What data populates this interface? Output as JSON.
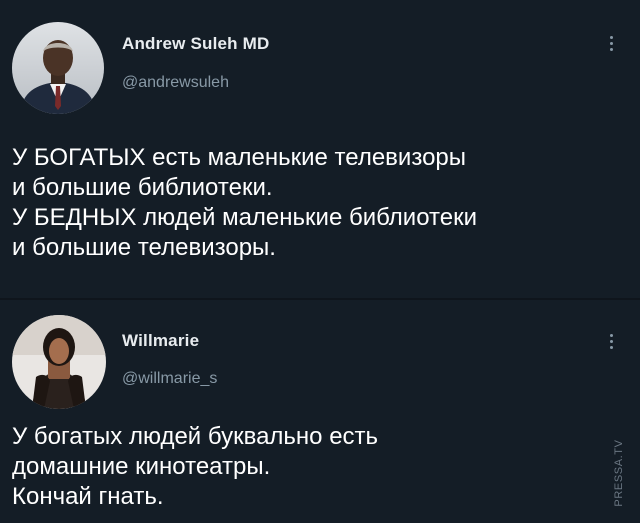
{
  "tweets": [
    {
      "display_name": "Andrew Suleh MD",
      "handle": "@andrewsuleh",
      "avatar_icon": "person-photo-icon",
      "more_icon": "vertical-ellipsis-icon",
      "text_lines": [
        "У БОГАТЫХ есть маленькие телевизоры",
        "и большие библиотеки.",
        "У БЕДНЫХ людей маленькие библиотеки",
        "и большие телевизоры."
      ]
    },
    {
      "display_name": "Willmarie",
      "handle": "@willmarie_s",
      "avatar_icon": "person-photo-icon",
      "more_icon": "vertical-ellipsis-icon",
      "text_lines": [
        "У богатых людей буквально есть",
        "домашние кинотеатры.",
        "Кончай гнать."
      ]
    }
  ],
  "watermark": "PRESSA.TV",
  "colors": {
    "background": "#141d26",
    "text": "#ffffff",
    "secondary_text": "#8899a6"
  }
}
